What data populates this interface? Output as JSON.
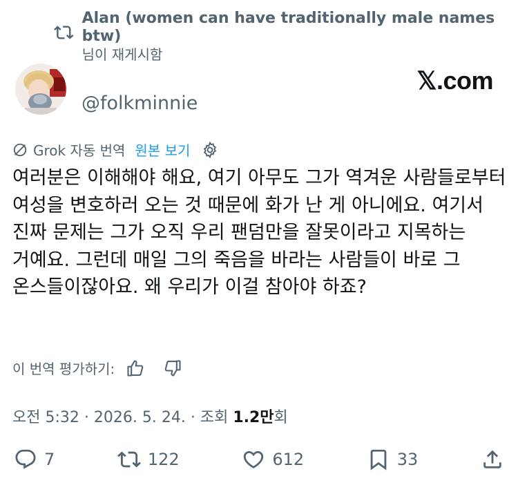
{
  "retweet": {
    "name": "Alan (women can have traditionally male names btw)",
    "suffix": "님이 재게시함"
  },
  "author": {
    "handle": "@folkminnie"
  },
  "watermark": "𝕏.com",
  "translation": {
    "label": "Grok 자동 번역",
    "view_original": "원본 보기"
  },
  "tweet": {
    "text": "여러분은 이해해야 해요, 여기 아무도 그가 역겨운 사람들로부터 여성을 변호하러 오는 것 때문에 화가 난 게 아니에요. 여기서 진짜 문제는 그가 오직 우리 팬덤만을 잘못이라고 지목하는 거예요. 그런데 매일 그의 죽음을 바라는 사람들이 바로 그 온스들이잖아요. 왜 우리가 이걸 참아야 하죠?"
  },
  "rating": {
    "label": "이 번역 평가하기:"
  },
  "meta": {
    "time": "오전 5:32",
    "date": "2026. 5. 24.",
    "views_prefix": "조회",
    "views_count": "1.2만",
    "views_suffix": "회"
  },
  "actions": {
    "replies": "7",
    "reposts": "122",
    "likes": "612",
    "bookmarks": "33"
  },
  "colors": {
    "text": "#0f1419",
    "secondary": "#536471",
    "link": "#1d9bf0"
  }
}
